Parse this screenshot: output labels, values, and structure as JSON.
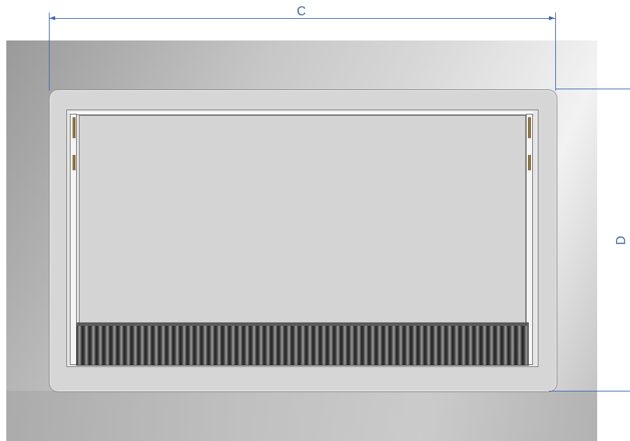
{
  "dimensions": {
    "width_label": "C",
    "height_label": "D"
  },
  "colors": {
    "dimension_line": "#3a68b0",
    "flange": "#d6d6d6",
    "grille": "#2b2b2b"
  }
}
